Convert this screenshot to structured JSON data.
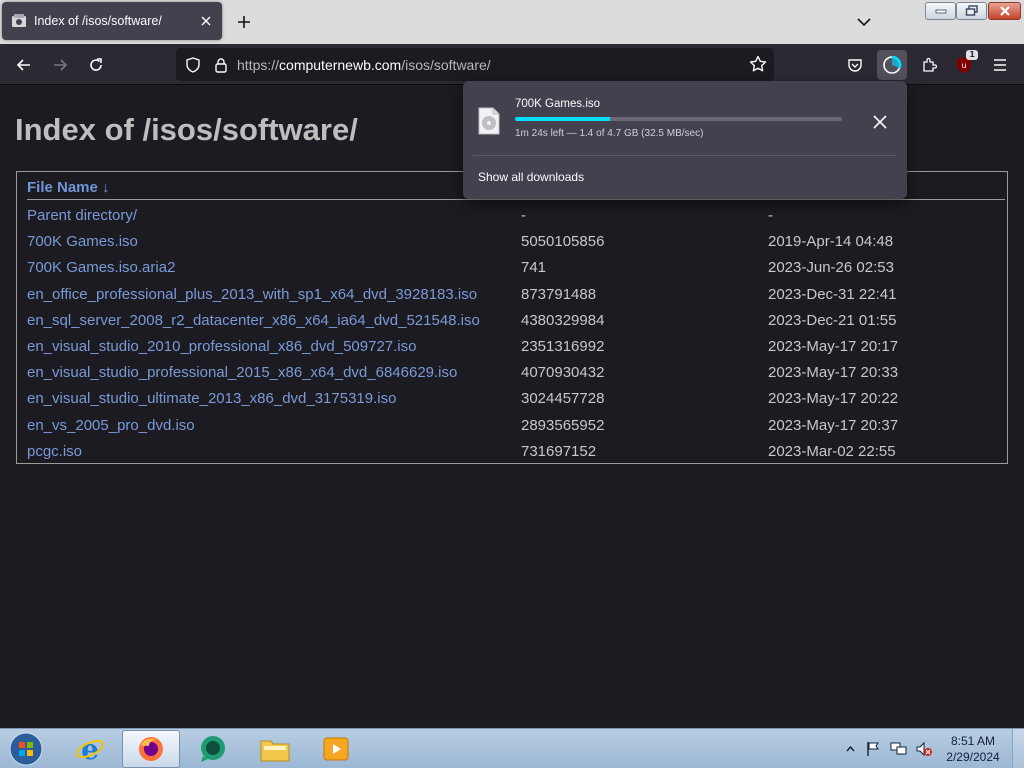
{
  "tab": {
    "title": "Index of /isos/software/",
    "favicon": "folder-icon"
  },
  "nav": {
    "url_scheme": "https://",
    "url_host": "computernewb.com",
    "url_path": "/isos/software/",
    "extension_badge": "1"
  },
  "page": {
    "title": "Index of /isos/software/",
    "header_name": "File Name",
    "sort_arrow": "↓",
    "rows": [
      {
        "name": "Parent directory/",
        "size": "-",
        "date": "-"
      },
      {
        "name": "700K Games.iso",
        "size": "5050105856",
        "date": "2019-Apr-14 04:48"
      },
      {
        "name": "700K Games.iso.aria2",
        "size": "741",
        "date": "2023-Jun-26 02:53"
      },
      {
        "name": "en_office_professional_plus_2013_with_sp1_x64_dvd_3928183.iso",
        "size": "873791488",
        "date": "2023-Dec-31 22:41"
      },
      {
        "name": "en_sql_server_2008_r2_datacenter_x86_x64_ia64_dvd_521548.iso",
        "size": "4380329984",
        "date": "2023-Dec-21 01:55"
      },
      {
        "name": "en_visual_studio_2010_professional_x86_dvd_509727.iso",
        "size": "2351316992",
        "date": "2023-May-17 20:17"
      },
      {
        "name": "en_visual_studio_professional_2015_x86_x64_dvd_6846629.iso",
        "size": "4070930432",
        "date": "2023-May-17 20:33"
      },
      {
        "name": "en_visual_studio_ultimate_2013_x86_dvd_3175319.iso",
        "size": "3024457728",
        "date": "2023-May-17 20:22"
      },
      {
        "name": "en_vs_2005_pro_dvd.iso",
        "size": "2893565952",
        "date": "2023-May-17 20:37"
      },
      {
        "name": "pcgc.iso",
        "size": "731697152",
        "date": "2023-Mar-02 22:55"
      }
    ]
  },
  "downloads": {
    "file_name": "700K Games.iso",
    "progress": 0.29,
    "status": "1m 24s left — 1.4 of 4.7 GB (32.5 MB/sec)",
    "show_all": "Show all downloads"
  },
  "taskbar": {
    "time": "8:51 AM",
    "date": "2/29/2024"
  },
  "colors": {
    "accent": "#00ddff",
    "link": "#7a9ad6"
  }
}
